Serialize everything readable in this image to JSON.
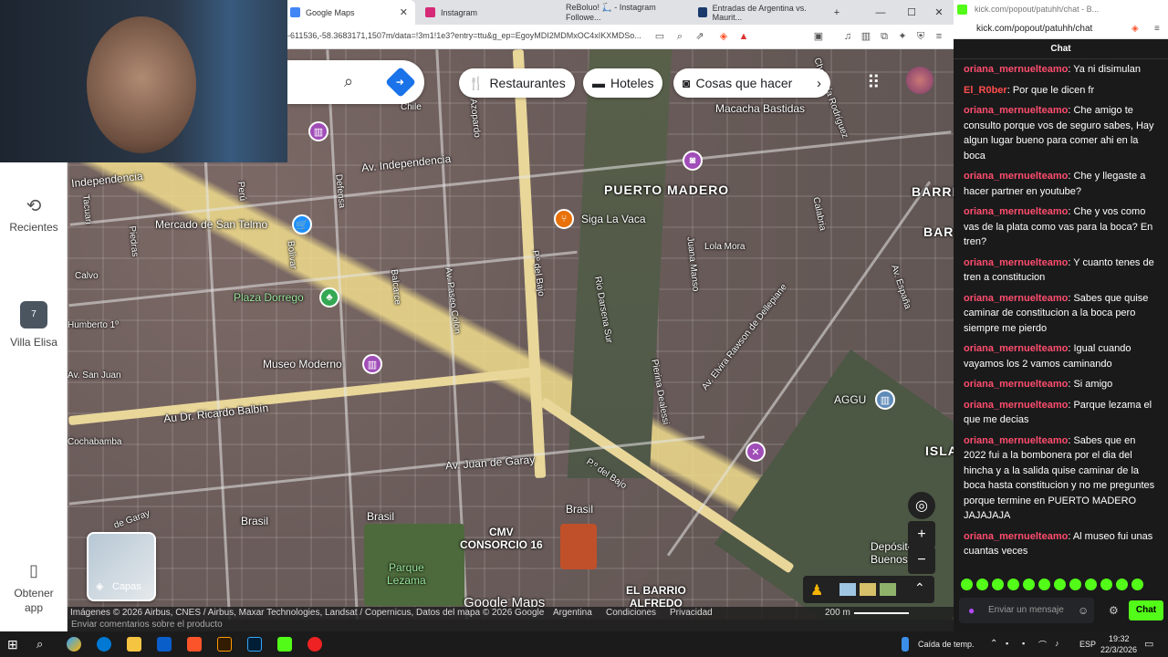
{
  "browser": {
    "tabs": [
      {
        "label": "Google Maps",
        "color": "#4285f4"
      },
      {
        "label": "Instagram",
        "color": "#d62976"
      },
      {
        "label": "ReBoluo! 🛴 - Instagram Followe...",
        "color": "#c13584"
      },
      {
        "label": "Entradas de Argentina vs. Maurit...",
        "color": "#1a3a6b"
      }
    ],
    "url": "-611536,-58.3683171,1507m/data=!3m1!1e3?entry=ttu&g_ep=EgoyMDI2MDMxOC4xIKXMDSo..."
  },
  "maps": {
    "chips": [
      {
        "label": "Restaurantes",
        "icon": "fork-knife-icon"
      },
      {
        "label": "Hoteles",
        "icon": "bed-icon"
      },
      {
        "label": "Cosas que hacer",
        "icon": "camera-icon"
      }
    ],
    "rail": {
      "recent": "Recientes",
      "place": "Villa Elisa",
      "place_badge": "7",
      "get_app": "Obtener app"
    },
    "layers_label": "Capas",
    "labels": {
      "chile": "Chile",
      "independencia": "Av. Independencia",
      "independencia2": "Independencia",
      "mercado": "Mercado de San Telmo",
      "plaza": "Plaza Dorrego",
      "museo": "Museo Moderno",
      "puerto": "PUERTO MADERO",
      "vaca": "Siga La Vaca",
      "lola": "Lola Mora",
      "rio": "Rio Darsena Sur",
      "colon": "Av. Paseo Colón",
      "bajo": "P.º del Bajo",
      "bajo2": "P.º del Bajo",
      "balbin": "Au Dr. Ricardo Balbín",
      "garay": "Av. Juan de Garay",
      "rawson": "Av. Elvira Rawson de Dellepiane",
      "aggu": "AGGU",
      "brasil": "Brasil",
      "brasil2": "Brasil",
      "brasil3": "Brasil",
      "cmv": "CMV\nCONSORCIO 16",
      "lezama": "Parque\nLezama",
      "barrio": "EL BARRIO\nALFREDO",
      "deposito": "Depósito Fi\nBuenos A",
      "sanjuan": "Av. San Juan",
      "humberto": "Humberto 1º",
      "calvo": "Calvo",
      "cochabamba": "Cochabamba",
      "garay2": "de Garay",
      "pietas": "Piedras",
      "tacuari": "Tacuari",
      "defensa": "Defensa",
      "bolivar": "Bolívar",
      "balcarce": "Balcarce",
      "peru": "Perú",
      "acoyte": "Azopardo",
      "espana": "Av. España",
      "calabria": "Calabria",
      "mosca": "Macacha Bastidas",
      "manso": "Juana Manso",
      "dealessi": "Pierina Dealessi",
      "chavarrodriguez": "Chavarría Rodríguez",
      "barrio2": "BARRIO",
      "barr": "BARR",
      "isla": "ISLA"
    },
    "attribution": "Imágenes © 2026 Airbus, CNES / Airbus, Maxar Technologies, Landsat / Copernicus, Datos del mapa © 2026 Google",
    "footer_links": [
      "Argentina",
      "Condiciones",
      "Privacidad"
    ],
    "scale": "200 m",
    "feedback": "Enviar comentarios sobre el producto",
    "logo": "Google Maps"
  },
  "kick": {
    "title": "kick.com/popout/patuhh/chat - B...",
    "address": "kick.com/popout/patuhh/chat",
    "header": "Chat",
    "messages": [
      {
        "user": "oriana_mernuelteamo",
        "color": "#ff4d6d",
        "text": "Ya ni disimulan"
      },
      {
        "user": "El_R0ber",
        "color": "#ff4d4d",
        "text": "Por que le dicen fr"
      },
      {
        "user": "oriana_mernuelteamo",
        "color": "#ff4d6d",
        "text": "Che amigo te consulto porque vos de seguro sabes, Hay algun lugar bueno para comer ahi en la boca"
      },
      {
        "user": "oriana_mernuelteamo",
        "color": "#ff4d6d",
        "text": "Che y llegaste a hacer partner en youtube?"
      },
      {
        "user": "oriana_mernuelteamo",
        "color": "#ff4d6d",
        "text": "Che y vos como vas de la plata como vas para la boca? En tren?"
      },
      {
        "user": "oriana_mernuelteamo",
        "color": "#ff4d6d",
        "text": "Y cuanto tenes de tren a constitucion"
      },
      {
        "user": "oriana_mernuelteamo",
        "color": "#ff4d6d",
        "text": "Sabes que quise caminar de constitucion a la boca pero siempre me pierdo"
      },
      {
        "user": "oriana_mernuelteamo",
        "color": "#ff4d6d",
        "text": "Igual cuando vayamos los 2 vamos caminando"
      },
      {
        "user": "oriana_mernuelteamo",
        "color": "#ff4d6d",
        "text": "Si amigo"
      },
      {
        "user": "oriana_mernuelteamo",
        "color": "#ff4d6d",
        "text": "Parque lezama el que me decias"
      },
      {
        "user": "oriana_mernuelteamo",
        "color": "#ff4d6d",
        "text": "Sabes que en 2022 fui a la bombonera por el dia del hincha y a la salida quise caminar de la boca hasta constitucion y no me preguntes porque termine en PUERTO MADERO JAJAJAJA"
      },
      {
        "user": "oriana_mernuelteamo",
        "color": "#ff4d6d",
        "text": "Al museo fui unas cuantas veces"
      }
    ],
    "input_placeholder": "Enviar un mensaje",
    "send_label": "Chat"
  },
  "taskbar": {
    "weather": "Caída de temp.",
    "lang": "ESP",
    "time": "19:32",
    "date": "22/3/2026"
  }
}
